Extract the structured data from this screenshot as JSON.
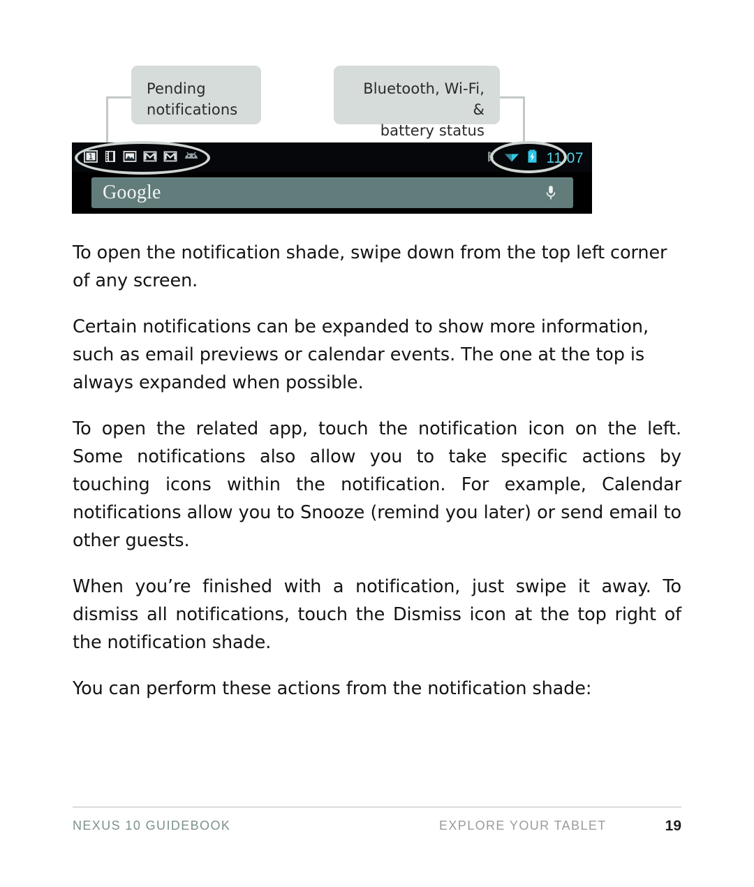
{
  "figure": {
    "callouts": [
      {
        "id": "pending-notifications",
        "text": "Pending\nnotifications",
        "line1": "Pending",
        "line2": "notifications",
        "align": "left"
      },
      {
        "id": "status-icons",
        "text": "Bluetooth, Wi-Fi, &\nbattery status",
        "line1": "Bluetooth, Wi-Fi, &",
        "line2": "battery status",
        "align": "right"
      }
    ],
    "device": {
      "status_bar": {
        "notification_icons": [
          {
            "name": "calendar-icon",
            "label": "1"
          },
          {
            "name": "film-strip-icon",
            "label": ""
          },
          {
            "name": "photo-icon",
            "label": ""
          },
          {
            "name": "gmail-icon",
            "label": "M"
          },
          {
            "name": "gmail-icon",
            "label": "M"
          },
          {
            "name": "android-robot-icon",
            "label": ""
          }
        ],
        "status_icons": [
          {
            "name": "bluetooth-icon",
            "color": "#8b9296"
          },
          {
            "name": "wifi-icon",
            "color": "#36c6dd"
          },
          {
            "name": "battery-charging-icon",
            "color": "#2ec7e8"
          }
        ],
        "clock": "11:07"
      },
      "search_bar": {
        "logo_text": "Google",
        "mic_icon": "microphone-icon"
      }
    },
    "colors": {
      "callout_bg": "#d6dcd9",
      "leader_line": "#c3c9c6",
      "ellipse_stroke": "#cfd6d2",
      "device_bg": "#000000",
      "search_bar_bg": "#7a9b9b",
      "accent_cyan": "#36c6dd"
    }
  },
  "body": {
    "paragraphs": [
      {
        "id": "p-open-shade",
        "justify": false,
        "text": "To open the notification shade, swipe down from the top left corner of any screen."
      },
      {
        "id": "p-expandable",
        "justify": false,
        "text": "Certain notifications can be expanded to show more information, such as email previews or calendar events. The one at the top is always expanded when possible."
      },
      {
        "id": "p-open-app",
        "justify": true,
        "text": "To open the related app, touch the notification icon on the left. Some notifications also allow you to take specific actions by touching icons within the notification. For example, Calendar notifications allow you to Snooze (remind you later) or send email to other guests."
      },
      {
        "id": "p-dismiss",
        "justify": true,
        "text": "When you’re finished with a notification, just swipe it away. To dismiss all notifications, touch the Dismiss icon at the top right of the notification shade."
      },
      {
        "id": "p-actions-lead",
        "justify": false,
        "text": "You can perform these actions from the notification shade:"
      }
    ]
  },
  "footer": {
    "left": "NEXUS 10 GUIDEBOOK",
    "center": "EXPLORE YOUR TABLET",
    "page_number": "19",
    "colors": {
      "left": "#7e918d",
      "center": "#9b9b9b",
      "page": "#1c1c1c"
    }
  }
}
